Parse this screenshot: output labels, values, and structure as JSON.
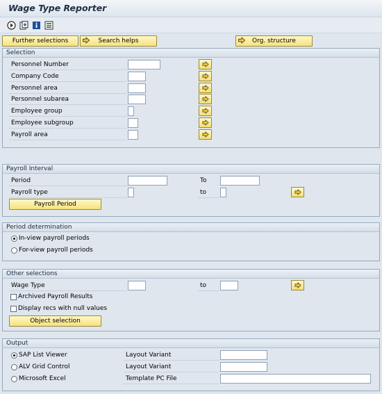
{
  "title": "Wage Type Reporter",
  "toolbar_icons": [
    "execute-icon",
    "variant-icon",
    "info-icon",
    "selection-options-icon"
  ],
  "buttons": {
    "further_selections": "Further selections",
    "search_helps": "Search helps",
    "org_structure": "Org. structure"
  },
  "selection": {
    "header": "Selection",
    "fields": [
      "Personnel Number",
      "Company Code",
      "Personnel area",
      "Personnel subarea",
      "Employee group",
      "Employee subgroup",
      "Payroll area"
    ]
  },
  "payroll_interval": {
    "header": "Payroll Interval",
    "period_label": "Period",
    "to_label": "To",
    "payroll_type_label": "Payroll type",
    "to_label2": "to",
    "payroll_period_button": "Payroll Period"
  },
  "period_determination": {
    "header": "Period determination",
    "options": [
      "In-view payroll periods",
      "For-view payroll periods"
    ],
    "selected": "In-view payroll periods"
  },
  "other_selections": {
    "header": "Other selections",
    "wage_type_label": "Wage Type",
    "to_label": "to",
    "archived": "Archived Payroll Results",
    "null_values": "Display recs with null values",
    "object_selection_button": "Object selection"
  },
  "output": {
    "header": "Output",
    "options": [
      "SAP List Viewer",
      "ALV Grid Control",
      "Microsoft Excel"
    ],
    "selected": "SAP List Viewer",
    "right_labels": [
      "Layout Variant",
      "Layout Variant",
      "Template PC File"
    ]
  },
  "colors": {
    "button_yellow": "#f7e27b",
    "group_border": "#97a9bd",
    "background": "#dfe6ed"
  }
}
